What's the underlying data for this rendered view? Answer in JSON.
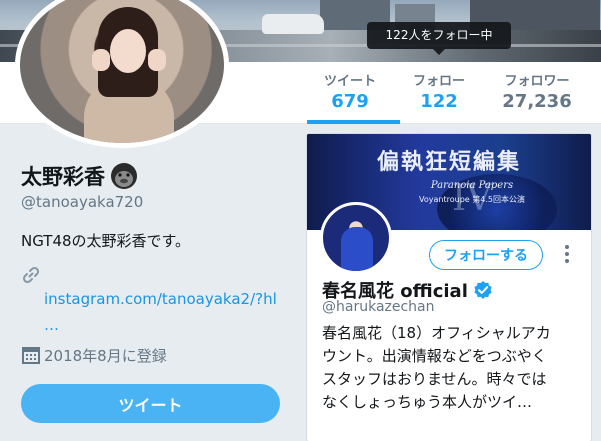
{
  "header": {
    "tooltip": "122人をフォロー中"
  },
  "stats": {
    "tweets": {
      "label": "ツイート",
      "value": "679"
    },
    "following": {
      "label": "フォロー",
      "value": "122"
    },
    "followers": {
      "label": "フォロワー",
      "value": "27,236"
    }
  },
  "profile": {
    "name": "太野彩香",
    "name_emoji_icon": "gorilla-icon",
    "handle": "@tanoayaka720",
    "bio": "NGT48の太野彩香です。",
    "link": "instagram.com/tanoayaka2/?hl",
    "link_more": "…",
    "joined": "2018年8月に登録",
    "tweet_button": "ツイート"
  },
  "hover_card": {
    "banner_title": "偏執狂短編集",
    "banner_numeral": "IV",
    "banner_subtitle": "Paranoia Papers",
    "banner_caption": "Voyantroupe 第4.5回本公演",
    "follow_button": "フォローする",
    "name": "春名風花 official",
    "handle": "@harukazechan",
    "bio_lines": [
      "春名風花（18）オフィシャルアカ",
      "ウント。出演情報などをつぶやく",
      "スタッフはおりません。時々では",
      "なくしょっちゅう本人がツイ…"
    ]
  },
  "colors": {
    "accent": "#1da1f2",
    "button": "#4ab3f4",
    "background": "#e6ecf0",
    "text": "#14171a",
    "muted": "#657786"
  }
}
